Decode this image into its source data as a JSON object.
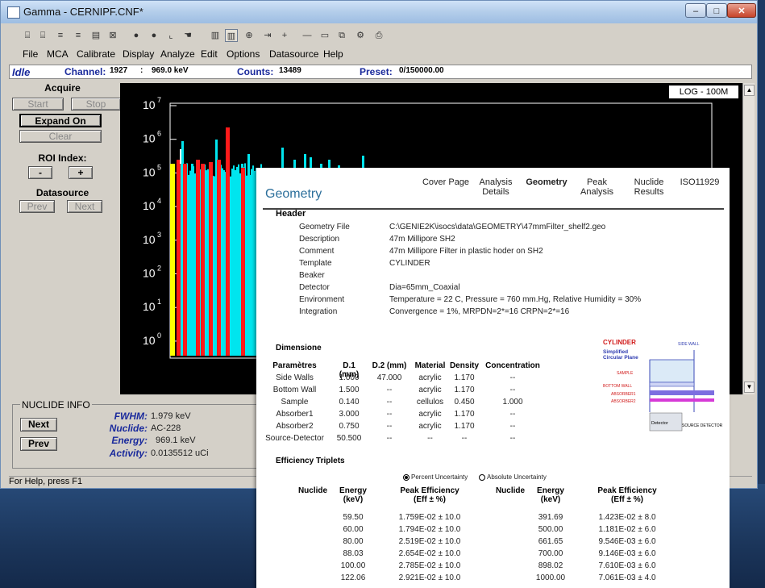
{
  "window": {
    "title": "Gamma - CERNIPF.CNF*",
    "min": "–",
    "max": "□",
    "close": "✕"
  },
  "toolbar_icons": [
    "open-icon",
    "open-file-icon",
    "move-up-icon",
    "move-down-icon",
    "save-icon",
    "grid-icon",
    "circle-icon",
    "circle-icon-2",
    "bracket-icon",
    "hand-icon",
    "bars-icon",
    "bars-zoom-icon",
    "zoom-in-icon",
    "move-icon",
    "cross-icon",
    "minus-icon",
    "window-icon",
    "restore-icon",
    "print-setup-icon",
    "printer-icon"
  ],
  "menu": [
    "File",
    "MCA",
    "Calibrate",
    "Display",
    "Analyze",
    "Edit",
    "Options",
    "Datasource",
    "Help"
  ],
  "status": {
    "state": "Idle",
    "channel_label": "Channel:",
    "channel": "1927",
    "sep": ":",
    "energy": "969.0 keV",
    "counts_label": "Counts:",
    "counts": "13489",
    "preset_label": "Preset:",
    "preset": "0/150000.00"
  },
  "panel": {
    "acquire": "Acquire",
    "start": "Start",
    "stop": "Stop",
    "expand": "Expand On",
    "clear": "Clear",
    "roi_label": "ROI Index:",
    "roi_minus": "-",
    "roi_plus": "+",
    "datasource": "Datasource",
    "prev": "Prev",
    "next": "Next"
  },
  "spectrum": {
    "scale": "LOG - 100M",
    "yticks": [
      "10",
      "10",
      "10",
      "10",
      "10",
      "10",
      "10",
      "10"
    ],
    "exps": [
      "7",
      "6",
      "5",
      "4",
      "3",
      "2",
      "1",
      "0"
    ]
  },
  "nuclide_info": {
    "title": "NUCLIDE INFO",
    "next": "Next",
    "prev": "Prev",
    "fwhm_label": "FWHM:",
    "fwhm": "1.979 keV",
    "nuclide_label": "Nuclide:",
    "nuclide": "AC-228",
    "energy_label": "Energy:",
    "energy": "969.1 keV",
    "activity_label": "Activity:",
    "activity": "0.0135512 uCi"
  },
  "statusbar": "For Help, press F1",
  "report": {
    "title": "Geometry",
    "nav": [
      "Cover Page",
      "Analysis\nDetails",
      "Geometry",
      "Peak\nAnalysis",
      "Nuclide\nResults",
      "ISO11929"
    ],
    "header": "Header",
    "fields": [
      {
        "label": "Geometry File",
        "value": "C:\\GENIE2K\\isocs\\data\\GEOMETRY\\47mmFilter_shelf2.geo"
      },
      {
        "label": "Description",
        "value": "47m Millipore SH2"
      },
      {
        "label": "Comment",
        "value": "47m Millipore Filter in plastic hoder on  SH2"
      },
      {
        "label": "Template",
        "value": "CYLINDER"
      },
      {
        "label": "Beaker",
        "value": ""
      },
      {
        "label": "Detector",
        "value": "Dia=65mm_Coaxial"
      },
      {
        "label": "Environment",
        "value": "Temperature = 22 C, Pressure = 760 mm.Hg, Relative Humidity = 30%"
      },
      {
        "label": "Integration",
        "value": "Convergence = 1%, MRPDN=2*=16 CRPN=2*=16"
      }
    ],
    "dims_title": "Dimensione",
    "dims_headers": [
      "Paramètres",
      "D.1 (mm)",
      "D.2 (mm)",
      "Material",
      "Density",
      "Concentration"
    ],
    "dims_rows": [
      [
        "Side Walls",
        "1.000",
        "47.000",
        "acrylic",
        "1.170",
        "--"
      ],
      [
        "Bottom Wall",
        "1.500",
        "--",
        "acrylic",
        "1.170",
        "--"
      ],
      [
        "Sample",
        "0.140",
        "--",
        "cellulos",
        "0.450",
        "1.000"
      ],
      [
        "Absorber1",
        "3.000",
        "--",
        "acrylic",
        "1.170",
        "--"
      ],
      [
        "Absorber2",
        "0.750",
        "--",
        "acrylic",
        "1.170",
        "--"
      ],
      [
        "Source-Detector",
        "50.500",
        "--",
        "--",
        "--",
        "--"
      ]
    ],
    "diagram": {
      "title": "CYLINDER",
      "subtitle": "Simplified\nCircular Plane",
      "side_wall": "SIDE WALL",
      "sample": "SAMPLE",
      "bottom": "BOTTOM WALL",
      "abs1": "ABSORBER1",
      "abs2": "ABSORBER2",
      "detector": "Detector",
      "source_det": "SOURCE DETECTOR"
    },
    "eff_title": "Efficiency Triplets",
    "radio_pct": "Percent Uncertainty",
    "radio_abs": "Absolute Uncertainty",
    "eff_headers": [
      "Nuclide",
      "Energy\n(keV)",
      "Peak Efficiency\n(Eff ± %)",
      "Nuclide",
      "Energy\n(keV)",
      "Peak Efficiency\n(Eff ± %)"
    ],
    "eff_rows": [
      [
        "59.50",
        "1.759E-02 ± 10.0",
        "391.69",
        "1.423E-02 ± 8.0"
      ],
      [
        "60.00",
        "1.794E-02 ± 10.0",
        "500.00",
        "1.181E-02 ± 6.0"
      ],
      [
        "80.00",
        "2.519E-02 ± 10.0",
        "661.65",
        "9.546E-03 ± 6.0"
      ],
      [
        "88.03",
        "2.654E-02 ± 10.0",
        "700.00",
        "9.146E-03 ± 6.0"
      ],
      [
        "100.00",
        "2.785E-02 ± 10.0",
        "898.02",
        "7.610E-03 ± 6.0"
      ],
      [
        "122.06",
        "2.921E-02 ± 10.0",
        "1000.00",
        "7.061E-03 ± 4.0"
      ]
    ]
  }
}
